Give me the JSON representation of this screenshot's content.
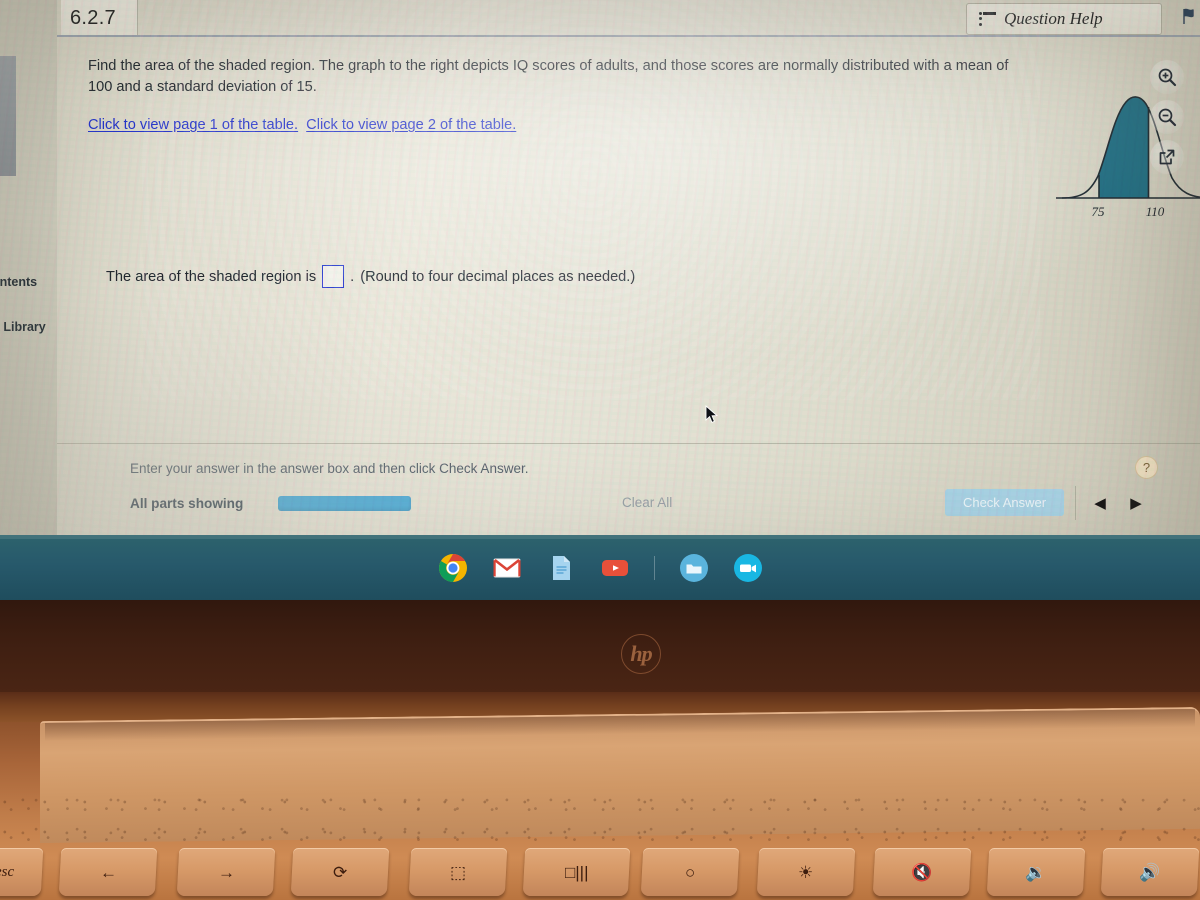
{
  "window": {
    "tab_label": "6.2.7",
    "question_help_label": "Question Help",
    "question_help_icon": "list-bullets-icon",
    "edge_icon": "flag-icon"
  },
  "sidebar": {
    "items": [
      {
        "label": "ontents",
        "name": "sidebar-item-contents"
      },
      {
        "label": "lia Library",
        "name": "sidebar-item-media-library"
      }
    ]
  },
  "problem": {
    "text": "Find the area of the shaded region. The graph to the right depicts IQ scores of adults, and those scores are normally distributed with a mean of 100 and a standard deviation of 15.",
    "links": [
      "Click to view page 1 of the table.",
      "Click to view page 2 of the table."
    ],
    "answer_prompt_before": "The area of the shaded region is",
    "answer_value": "",
    "answer_prompt_after": "(Round to four decimal places as needed.)"
  },
  "tools": [
    {
      "name": "zoom-in-icon",
      "label": "Zoom in"
    },
    {
      "name": "zoom-out-icon",
      "label": "Zoom out"
    },
    {
      "name": "pop-out-icon",
      "label": "Open in new window"
    }
  ],
  "footer": {
    "hint": "Enter your answer in the answer box and then click Check Answer.",
    "all_parts_label": "All parts showing",
    "progress_percent": 100,
    "clear_all_label": "Clear All",
    "check_answer_label": "Check Answer",
    "prev_label": "◀",
    "next_label": "▶",
    "help_label": "?"
  },
  "shelf": {
    "icons": [
      {
        "name": "chrome-icon",
        "label": "Chrome"
      },
      {
        "name": "gmail-icon",
        "label": "Gmail"
      },
      {
        "name": "google-docs-icon",
        "label": "Docs"
      },
      {
        "name": "youtube-icon",
        "label": "YouTube"
      },
      {
        "name": "files-icon",
        "label": "Files"
      },
      {
        "name": "video-camera-icon",
        "label": "Meet"
      }
    ]
  },
  "keyboard": {
    "keys": [
      {
        "name": "key-esc",
        "glyph": "esc"
      },
      {
        "name": "key-back",
        "glyph": "←"
      },
      {
        "name": "key-forward",
        "glyph": "→"
      },
      {
        "name": "key-reload",
        "glyph": "⟳"
      },
      {
        "name": "key-fullscreen",
        "glyph": "⬚"
      },
      {
        "name": "key-overview",
        "glyph": "□|||"
      },
      {
        "name": "key-brightness-down",
        "glyph": "○"
      },
      {
        "name": "key-brightness-up",
        "glyph": "☀"
      },
      {
        "name": "key-mute",
        "glyph": "🔇"
      },
      {
        "name": "key-volume-down",
        "glyph": "🔉"
      },
      {
        "name": "key-volume-up",
        "glyph": "🔊"
      }
    ]
  },
  "hardware": {
    "brand_logo": "hp"
  },
  "colors": {
    "curve_fill": "#1a6a80",
    "shelf": "#27596b",
    "link": "#2233cc",
    "progress": "#54b0db",
    "check_button": "#a9d3e6",
    "text": "#21282f"
  },
  "chart_data": {
    "type": "area",
    "title": "",
    "xlabel": "",
    "ylabel": "",
    "distribution": "normal",
    "mean": 100,
    "std_dev": 15,
    "tick_labels": [
      "75",
      "110"
    ],
    "tick_values": [
      75,
      110
    ],
    "shaded_region": {
      "from": 75,
      "to": 110,
      "fill": "#1a6a80"
    },
    "xlim": [
      45,
      155
    ],
    "grid": false,
    "legend": "none"
  }
}
